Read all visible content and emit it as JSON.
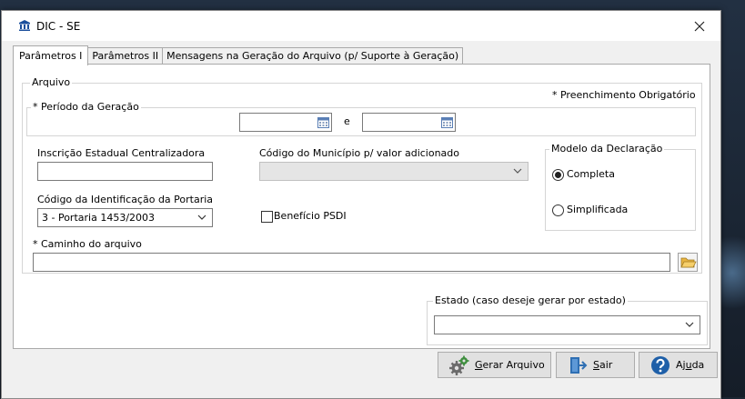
{
  "window": {
    "title": "DIC - SE"
  },
  "tabs": [
    {
      "label": "Parâmetros I"
    },
    {
      "label": "Parâmetros II"
    },
    {
      "label": "Mensagens na Geração do Arquivo (p/ Suporte à Geração)"
    }
  ],
  "arquivo": {
    "legend": "Arquivo",
    "required_note": "* Preenchimento Obrigatório",
    "periodo": {
      "legend": "* Período da Geração",
      "start": "",
      "end": "",
      "separator": "e"
    },
    "inscricao": {
      "label": "Inscrição Estadual Centralizadora",
      "value": ""
    },
    "codigo_municipio": {
      "label": "Código do Município p/ valor adicionado",
      "value": ""
    },
    "modelo": {
      "legend": "Modelo da Declaração",
      "options": [
        "Completa",
        "Simplificada"
      ],
      "selected": "Completa"
    },
    "portaria": {
      "label": "Código da Identificação da Portaria",
      "value": "3 - Portaria 1453/2003"
    },
    "beneficio": {
      "label": "Benefício PSDI",
      "checked": false
    },
    "caminho": {
      "label": "* Caminho do arquivo",
      "value": ""
    }
  },
  "estado": {
    "legend": "Estado (caso deseje gerar por estado)",
    "value": ""
  },
  "buttons": {
    "gerar": {
      "accel": "G",
      "rest": "erar Arquivo"
    },
    "sair": {
      "accel": "S",
      "rest": "air"
    },
    "ajuda": {
      "pre": "Aj",
      "accel": "u",
      "rest": "da"
    }
  },
  "colors": {
    "accent": "#0a6cc7",
    "dialog_bg": "#f0f0f0"
  }
}
